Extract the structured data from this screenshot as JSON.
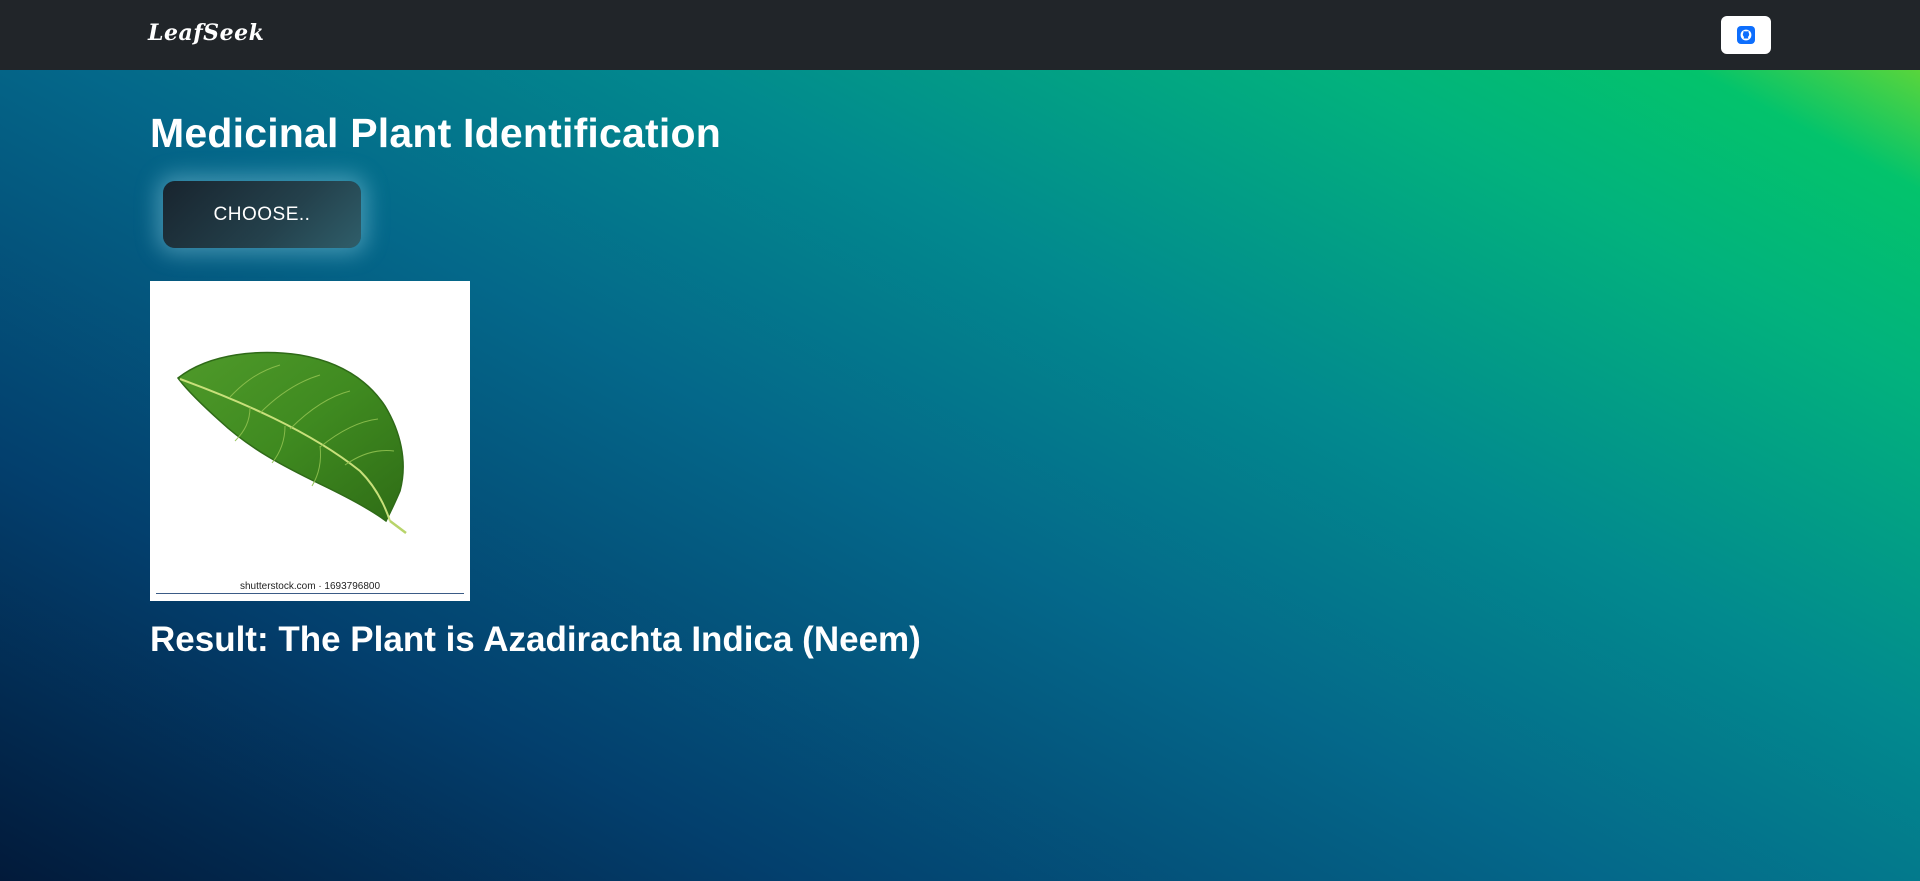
{
  "navbar": {
    "brand": "LeafSeek",
    "github_button_icon": "github-icon"
  },
  "main": {
    "title": "Medicinal Plant Identification",
    "choose_label": "CHOOSE..",
    "preview_watermark": "shutterstock.com · 1693796800",
    "result_text": "Result: The Plant is Azadirachta Indica (Neem)"
  },
  "colors": {
    "navbar_bg": "#212529",
    "accent_green": "#03c36c",
    "deep_blue": "#021a3a",
    "github_blue": "#0d6efd"
  }
}
